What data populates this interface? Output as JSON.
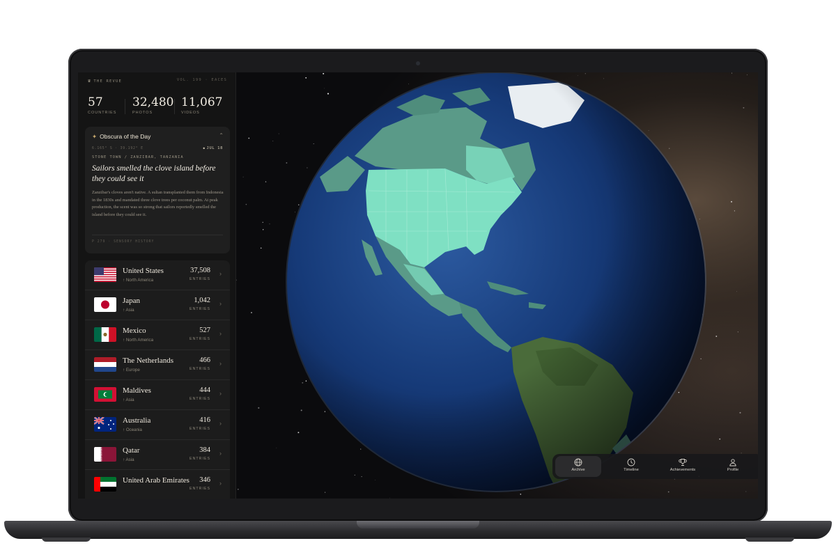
{
  "brand": {
    "name": "THE REVUE",
    "meta": "VOL. 199 · EACES"
  },
  "stats": [
    {
      "value": "57",
      "label": "COUNTRIES"
    },
    {
      "value": "32,480",
      "label": "PHOTOS"
    },
    {
      "value": "11,067",
      "label": "VIDEOS"
    }
  ],
  "obscura": {
    "title": "Obscura of the Day",
    "coords": "6.165° S · 39.192° E",
    "date": "JUL 18",
    "place": "STONE TOWN / ZANZIBAR, TANZANIA",
    "headline": "Sailors smelled the clove island before they could see it",
    "body": "Zanzibar's cloves aren't native. A sultan transplanted them from Indonesia in the 1830s and mandated three clove trees per coconut palm. At peak production, the scent was so strong that sailors reportedly smelled the island before they could see it.",
    "footer": "P 279 · SENSORY HISTORY"
  },
  "countries": [
    {
      "name": "United States",
      "region": "North America",
      "count": "37,508",
      "label": "ENTRIES",
      "flag": "us"
    },
    {
      "name": "Japan",
      "region": "Asia",
      "count": "1,042",
      "label": "ENTRIES",
      "flag": "jp"
    },
    {
      "name": "Mexico",
      "region": "North America",
      "count": "527",
      "label": "ENTRIES",
      "flag": "mx"
    },
    {
      "name": "The Netherlands",
      "region": "Europe",
      "count": "466",
      "label": "ENTRIES",
      "flag": "nl"
    },
    {
      "name": "Maldives",
      "region": "Asia",
      "count": "444",
      "label": "ENTRIES",
      "flag": "mv"
    },
    {
      "name": "Australia",
      "region": "Oceania",
      "count": "416",
      "label": "ENTRIES",
      "flag": "au"
    },
    {
      "name": "Qatar",
      "region": "Asia",
      "count": "384",
      "label": "ENTRIES",
      "flag": "qa"
    },
    {
      "name": "United Arab Emirates",
      "region": "",
      "count": "346",
      "label": "ENTRIES",
      "flag": "ae"
    }
  ],
  "tabs": [
    {
      "label": "Archive",
      "icon": "globe-icon",
      "active": true
    },
    {
      "label": "Timeline",
      "icon": "clock-icon",
      "active": false
    },
    {
      "label": "Achievements",
      "icon": "trophy-icon",
      "active": false
    },
    {
      "label": "Profile",
      "icon": "person-icon",
      "active": false
    }
  ],
  "colors": {
    "visited": "#7fe0c3",
    "ocean": "#1c3a6e",
    "accent": "#c7a86d"
  }
}
